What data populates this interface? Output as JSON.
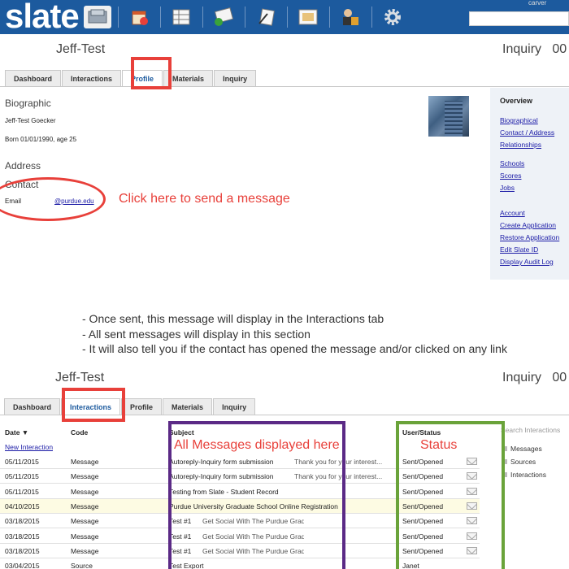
{
  "app": {
    "logo": "slate",
    "user": "carver"
  },
  "nav_icons": [
    "inbox-icon",
    "calendar-icon",
    "grid-icon",
    "mail-icon",
    "forms-icon",
    "event-icon",
    "users-icon",
    "gear-icon"
  ],
  "profile_view": {
    "record_name": "Jeff-Test",
    "record_type": "Inquiry",
    "record_id_partial": "00",
    "tabs": [
      "Dashboard",
      "Interactions",
      "Profile",
      "Materials",
      "Inquiry"
    ],
    "active_tab": "Profile",
    "biographic": {
      "title": "Biographic",
      "name": "Jeff-Test Goecker",
      "born": "Born 01/01/1990, age 25"
    },
    "address_title": "Address",
    "contact": {
      "title": "Contact",
      "email_label": "Email",
      "email_value": "@purdue.edu"
    },
    "overview": {
      "title": "Overview",
      "group1": [
        "Biographical",
        "Contact / Address",
        "Relationships"
      ],
      "group2": [
        "Schools",
        "Scores",
        "Jobs"
      ],
      "group3": [
        "Account",
        "Create Application",
        "Restore Application",
        "Edit Slate ID",
        "Display Audit Log"
      ]
    }
  },
  "annotations": {
    "click_here": "Click here to send a message",
    "bullets": [
      "- Once sent, this message will display in the Interactions tab",
      "- All sent messages will display in this section",
      "- It will also tell you if the contact has opened the message and/or clicked on any link"
    ],
    "all_messages": "All Messages displayed here",
    "status": "Status"
  },
  "interactions_view": {
    "record_name": "Jeff-Test",
    "record_type": "Inquiry",
    "record_id_partial": "00",
    "tabs": [
      "Dashboard",
      "Interactions",
      "Profile",
      "Materials",
      "Inquiry"
    ],
    "active_tab": "Interactions",
    "columns": {
      "date": "Date ▼",
      "code": "Code",
      "subject": "Subject",
      "status": "User/Status"
    },
    "new_interaction": "New Interaction",
    "rows": [
      {
        "date": "05/11/2015",
        "code": "Message",
        "subject": "Autoreply-Inquiry form submission",
        "preview": "Thank you for your interest...",
        "status": "Sent/Opened",
        "highlight": false,
        "mail": true
      },
      {
        "date": "05/11/2015",
        "code": "Message",
        "subject": "Autoreply-Inquiry form submission",
        "preview": "Thank you for your interest...",
        "status": "Sent/Opened",
        "highlight": false,
        "mail": true
      },
      {
        "date": "05/11/2015",
        "code": "Message",
        "subject": "Testing from Slate - Student Record",
        "preview": "",
        "status": "Sent/Opened",
        "highlight": false,
        "mail": true
      },
      {
        "date": "04/10/2015",
        "code": "Message",
        "subject": "Purdue University Graduate School Online Registration",
        "preview": "",
        "status": "Sent/Opened",
        "highlight": true,
        "mail": true
      },
      {
        "date": "03/18/2015",
        "code": "Message",
        "subject": "Test #1",
        "preview": "Get Social With The Purdue Graduate School",
        "status": "Sent/Opened",
        "highlight": false,
        "mail": true
      },
      {
        "date": "03/18/2015",
        "code": "Message",
        "subject": "Test #1",
        "preview": "Get Social With The Purdue Graduate School",
        "status": "Sent/Opened",
        "highlight": false,
        "mail": true
      },
      {
        "date": "03/18/2015",
        "code": "Message",
        "subject": "Test #1",
        "preview": "Get Social With The Purdue Graduate School",
        "status": "Sent/Opened",
        "highlight": false,
        "mail": true
      },
      {
        "date": "03/04/2015",
        "code": "Source",
        "subject": "Test Export",
        "preview": "",
        "status": "Janet",
        "highlight": false,
        "mail": false
      }
    ],
    "side_search_placeholder": "Search Interactions",
    "side_items": [
      "Messages",
      "Sources",
      "Interactions"
    ]
  },
  "colors": {
    "nav_blue": "#1c5a9e",
    "annotation_red": "#e8403a",
    "annotation_purple": "#5b2a86",
    "annotation_green": "#6aa33a",
    "link_blue": "#1a1aa6"
  }
}
